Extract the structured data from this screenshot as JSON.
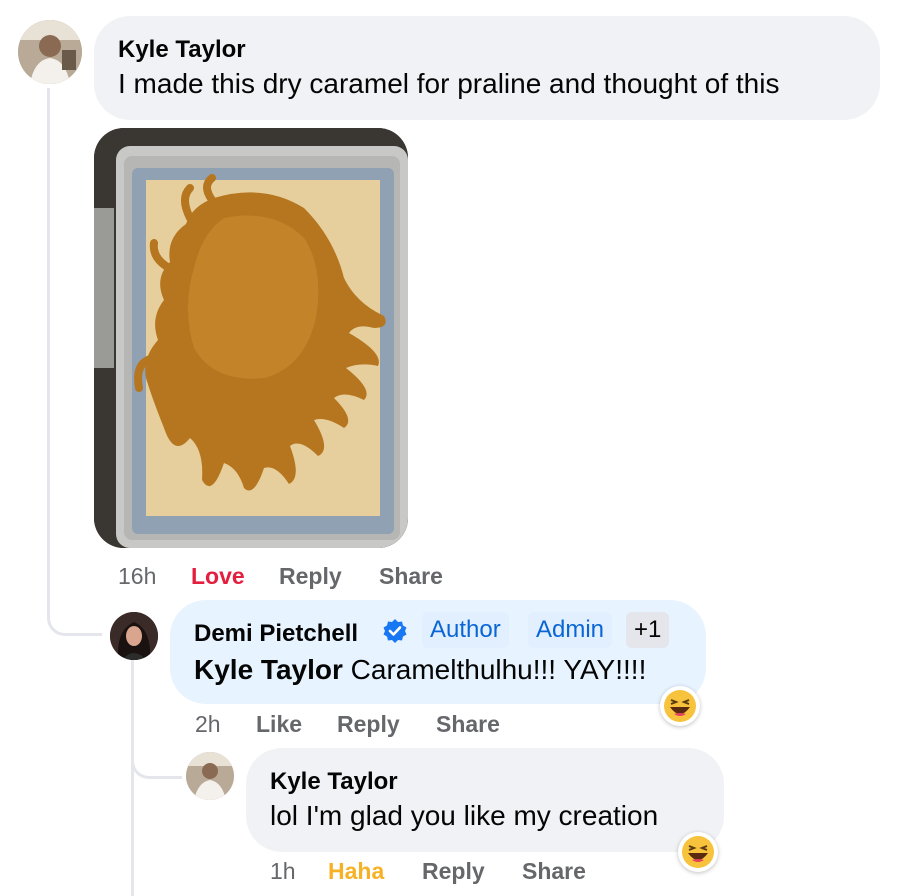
{
  "comments": [
    {
      "author": "Kyle Taylor",
      "text": "I made this dry caramel for praline and thought of this",
      "time": "16h",
      "reaction_label": "Love",
      "reply_label": "Reply",
      "share_label": "Share"
    },
    {
      "author": "Demi Pietchell",
      "verified_icon": "verified-badge-icon",
      "badges": [
        "Author",
        "Admin",
        "+1"
      ],
      "mention": "Kyle Taylor",
      "text": "Caramelthulhu!!! YAY!!!!",
      "time": "2h",
      "like_label": "Like",
      "reply_label": "Reply",
      "share_label": "Share",
      "reaction_icon": "haha-emoji-icon"
    },
    {
      "author": "Kyle Taylor",
      "text": "lol I'm glad you like my creation",
      "time": "1h",
      "reaction_label": "Haha",
      "reply_label": "Reply",
      "share_label": "Share",
      "reaction_icon": "haha-emoji-icon"
    }
  ],
  "colors": {
    "love": "#e41e3f",
    "haha": "#f7b125",
    "link_blue": "#0a66d6",
    "verified": "#1877f2",
    "meta_gray": "#65676b"
  }
}
